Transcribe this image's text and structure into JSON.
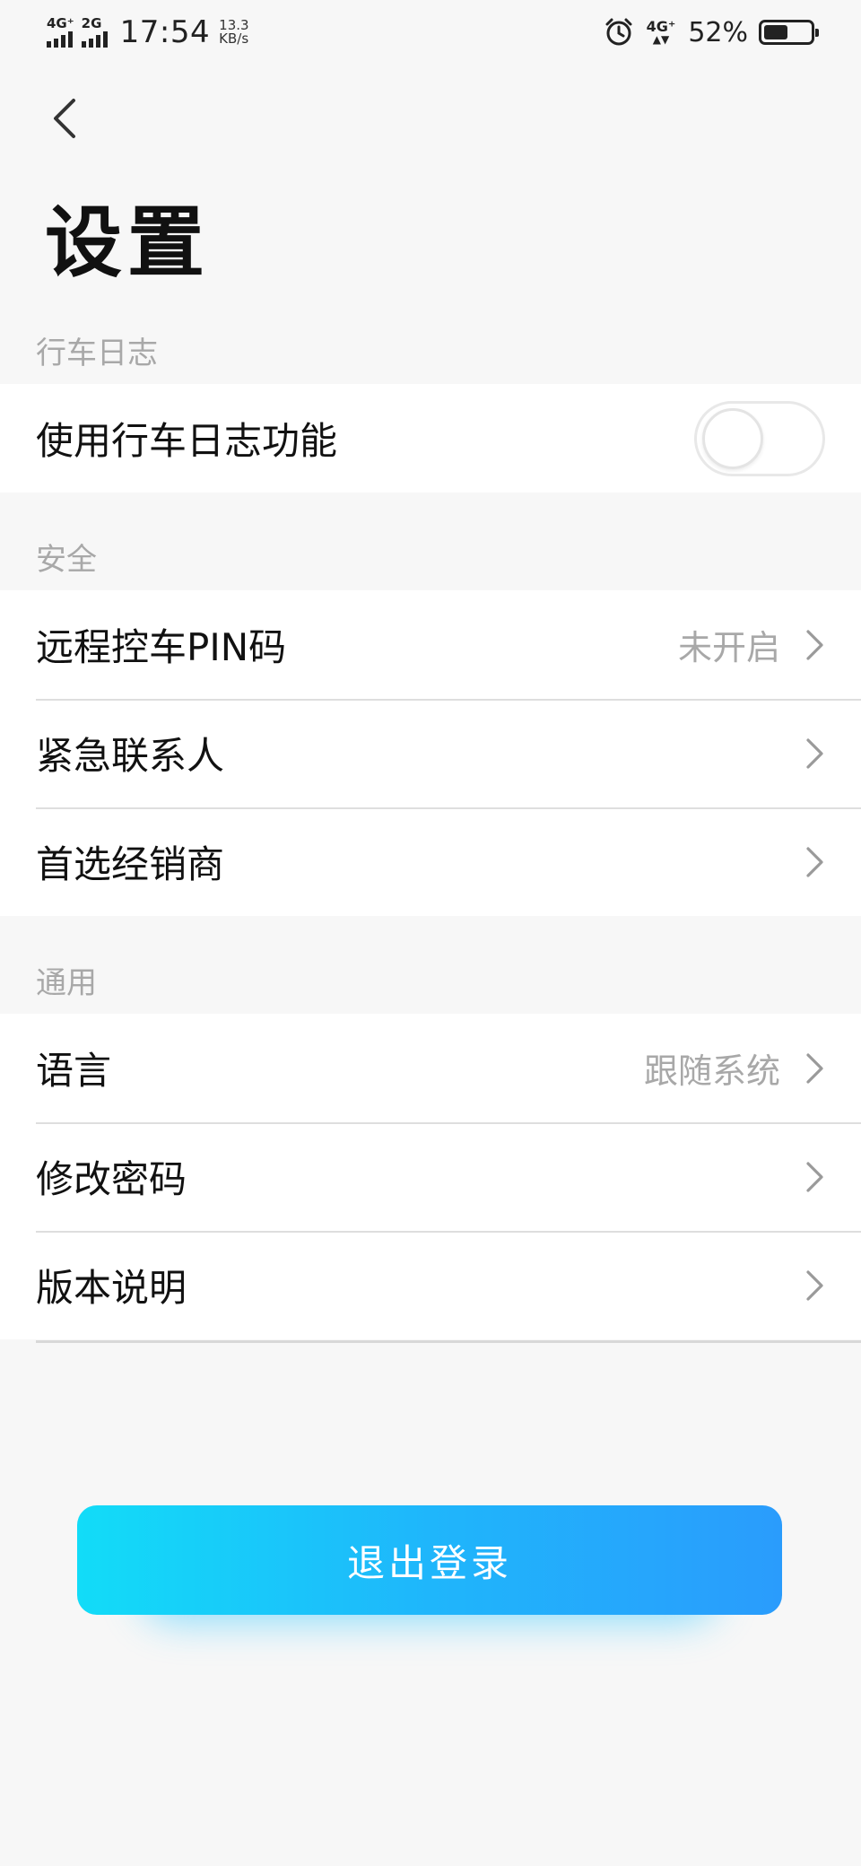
{
  "status_bar": {
    "net1": "4G⁺",
    "net2": "2G",
    "time": "17:54",
    "speed_value": "13.3",
    "speed_unit": "KB/s",
    "net_right": "4G⁺",
    "battery_percent": "52%",
    "battery_level": 0.52
  },
  "header": {
    "title": "设置"
  },
  "sections": {
    "driving_log": {
      "label": "行车日志",
      "items": [
        {
          "label": "使用行车日志功能",
          "toggle_on": false
        }
      ]
    },
    "security": {
      "label": "安全",
      "items": [
        {
          "label": "远程控车PIN码",
          "value": "未开启"
        },
        {
          "label": "紧急联系人"
        },
        {
          "label": "首选经销商"
        }
      ]
    },
    "general": {
      "label": "通用",
      "items": [
        {
          "label": "语言",
          "value": "跟随系统"
        },
        {
          "label": "修改密码"
        },
        {
          "label": "版本说明"
        }
      ]
    }
  },
  "logout_button": {
    "label": "退出登录"
  },
  "colors": {
    "background": "#f7f7f7",
    "section_label": "#a8a8a8",
    "accent_start": "#12dcf8",
    "accent_end": "#2a9cfc"
  }
}
